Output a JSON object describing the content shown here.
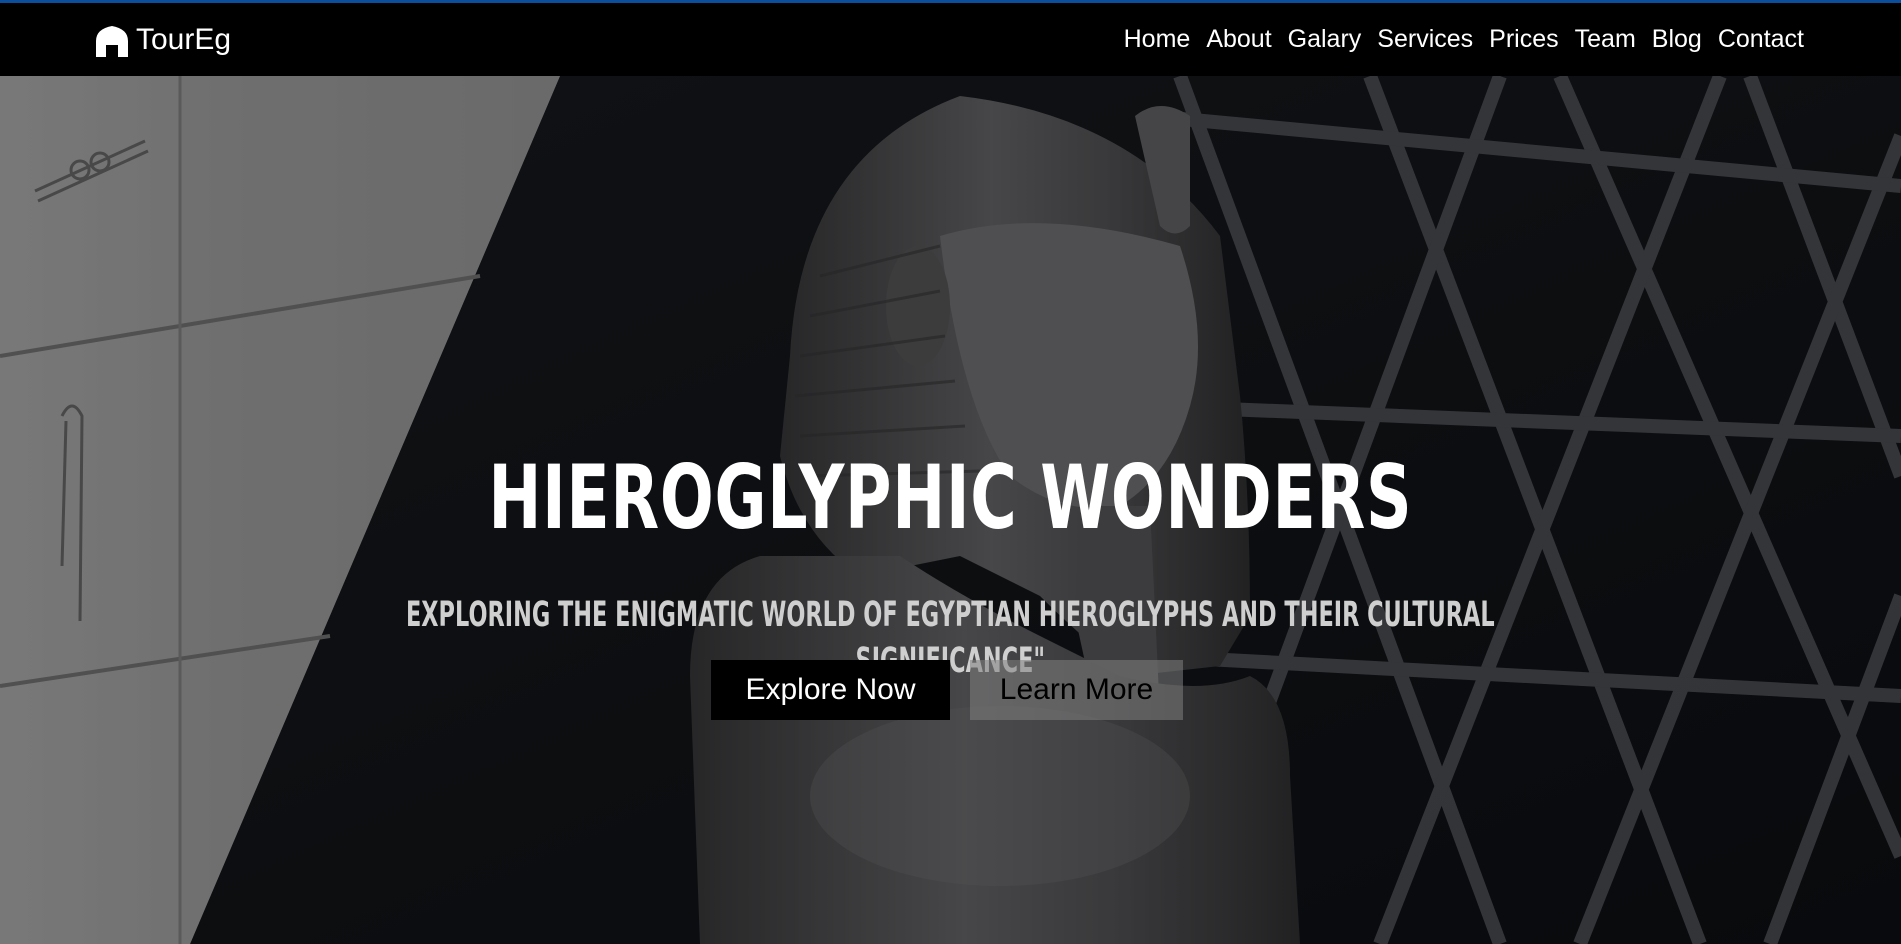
{
  "brand": {
    "name": "TourEg",
    "icon": "home-icon"
  },
  "nav": {
    "items": [
      {
        "label": "Home"
      },
      {
        "label": "About"
      },
      {
        "label": "Galary"
      },
      {
        "label": "Services"
      },
      {
        "label": "Prices"
      },
      {
        "label": "Team"
      },
      {
        "label": "Blog"
      },
      {
        "label": "Contact"
      }
    ]
  },
  "hero": {
    "title": "HIEROGLYPHIC WONDERS",
    "subtitle": "EXPLORING THE ENIGMATIC WORLD OF EGYPTIAN HIEROGLYPHS AND THEIR CULTURAL SIGNIFICANCE\"",
    "primary_button": "Explore Now",
    "secondary_button": "Learn More"
  },
  "colors": {
    "navbar_bg": "#000000",
    "accent_line": "#0b4f9c",
    "text_light": "#ffffff"
  }
}
